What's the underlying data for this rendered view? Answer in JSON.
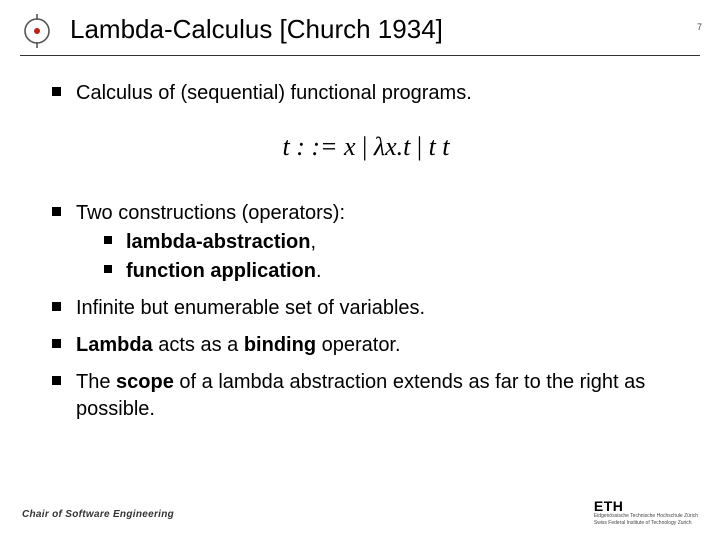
{
  "header": {
    "title": "Lambda-Calculus [Church 1934]",
    "page": "7"
  },
  "body": {
    "bullet1": "Calculus of (sequential) functional programs.",
    "formula": {
      "lhs": "t : := x",
      "p2": "λx.t",
      "p3": "t t"
    },
    "bullet2": {
      "lead": "Two constructions (operators):",
      "sub1": "lambda-abstraction",
      "sub2": "function application"
    },
    "bullet3": "Infinite but enumerable set of variables.",
    "bullet4": {
      "a": "Lambda",
      "b": " acts as a ",
      "c": "binding",
      "d": " operator."
    },
    "bullet5": {
      "a": "The ",
      "b": "scope",
      "c": " of a lambda abstraction extends as far to the right as possible."
    }
  },
  "footer": {
    "left": "Chair of Software Engineering",
    "right": {
      "logo": "ETH",
      "line1": "Eidgenössische Technische Hochschule Zürich",
      "line2": "Swiss Federal Institute of Technology Zurich"
    }
  }
}
